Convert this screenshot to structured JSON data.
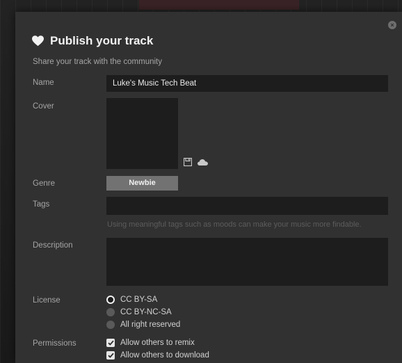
{
  "modal": {
    "title": "Publish your track",
    "subtitle": "Share your track with the community",
    "close_icon": "×"
  },
  "fields": {
    "name": {
      "label": "Name",
      "value": "Luke's Music Tech Beat"
    },
    "cover": {
      "label": "Cover",
      "icons": [
        "save-icon",
        "cloud-icon"
      ]
    },
    "genre": {
      "label": "Genre",
      "value": "Newbie"
    },
    "tags": {
      "label": "Tags",
      "value": "",
      "hint": "Using meaningful tags such as moods can make your music more findable."
    },
    "description": {
      "label": "Description",
      "value": ""
    },
    "license": {
      "label": "License",
      "options": [
        {
          "label": "CC BY-SA",
          "selected": true
        },
        {
          "label": "CC BY-NC-SA",
          "selected": false
        },
        {
          "label": "All right reserved",
          "selected": false
        }
      ]
    },
    "permissions": {
      "label": "Permissions",
      "options": [
        {
          "label": "Allow others to remix",
          "checked": true
        },
        {
          "label": "Allow others to download",
          "checked": true
        }
      ]
    }
  },
  "colors": {
    "modal_bg": "#313131",
    "input_bg": "#1d1d1d",
    "label": "#a5a5a5",
    "genre_button": "#727272"
  }
}
